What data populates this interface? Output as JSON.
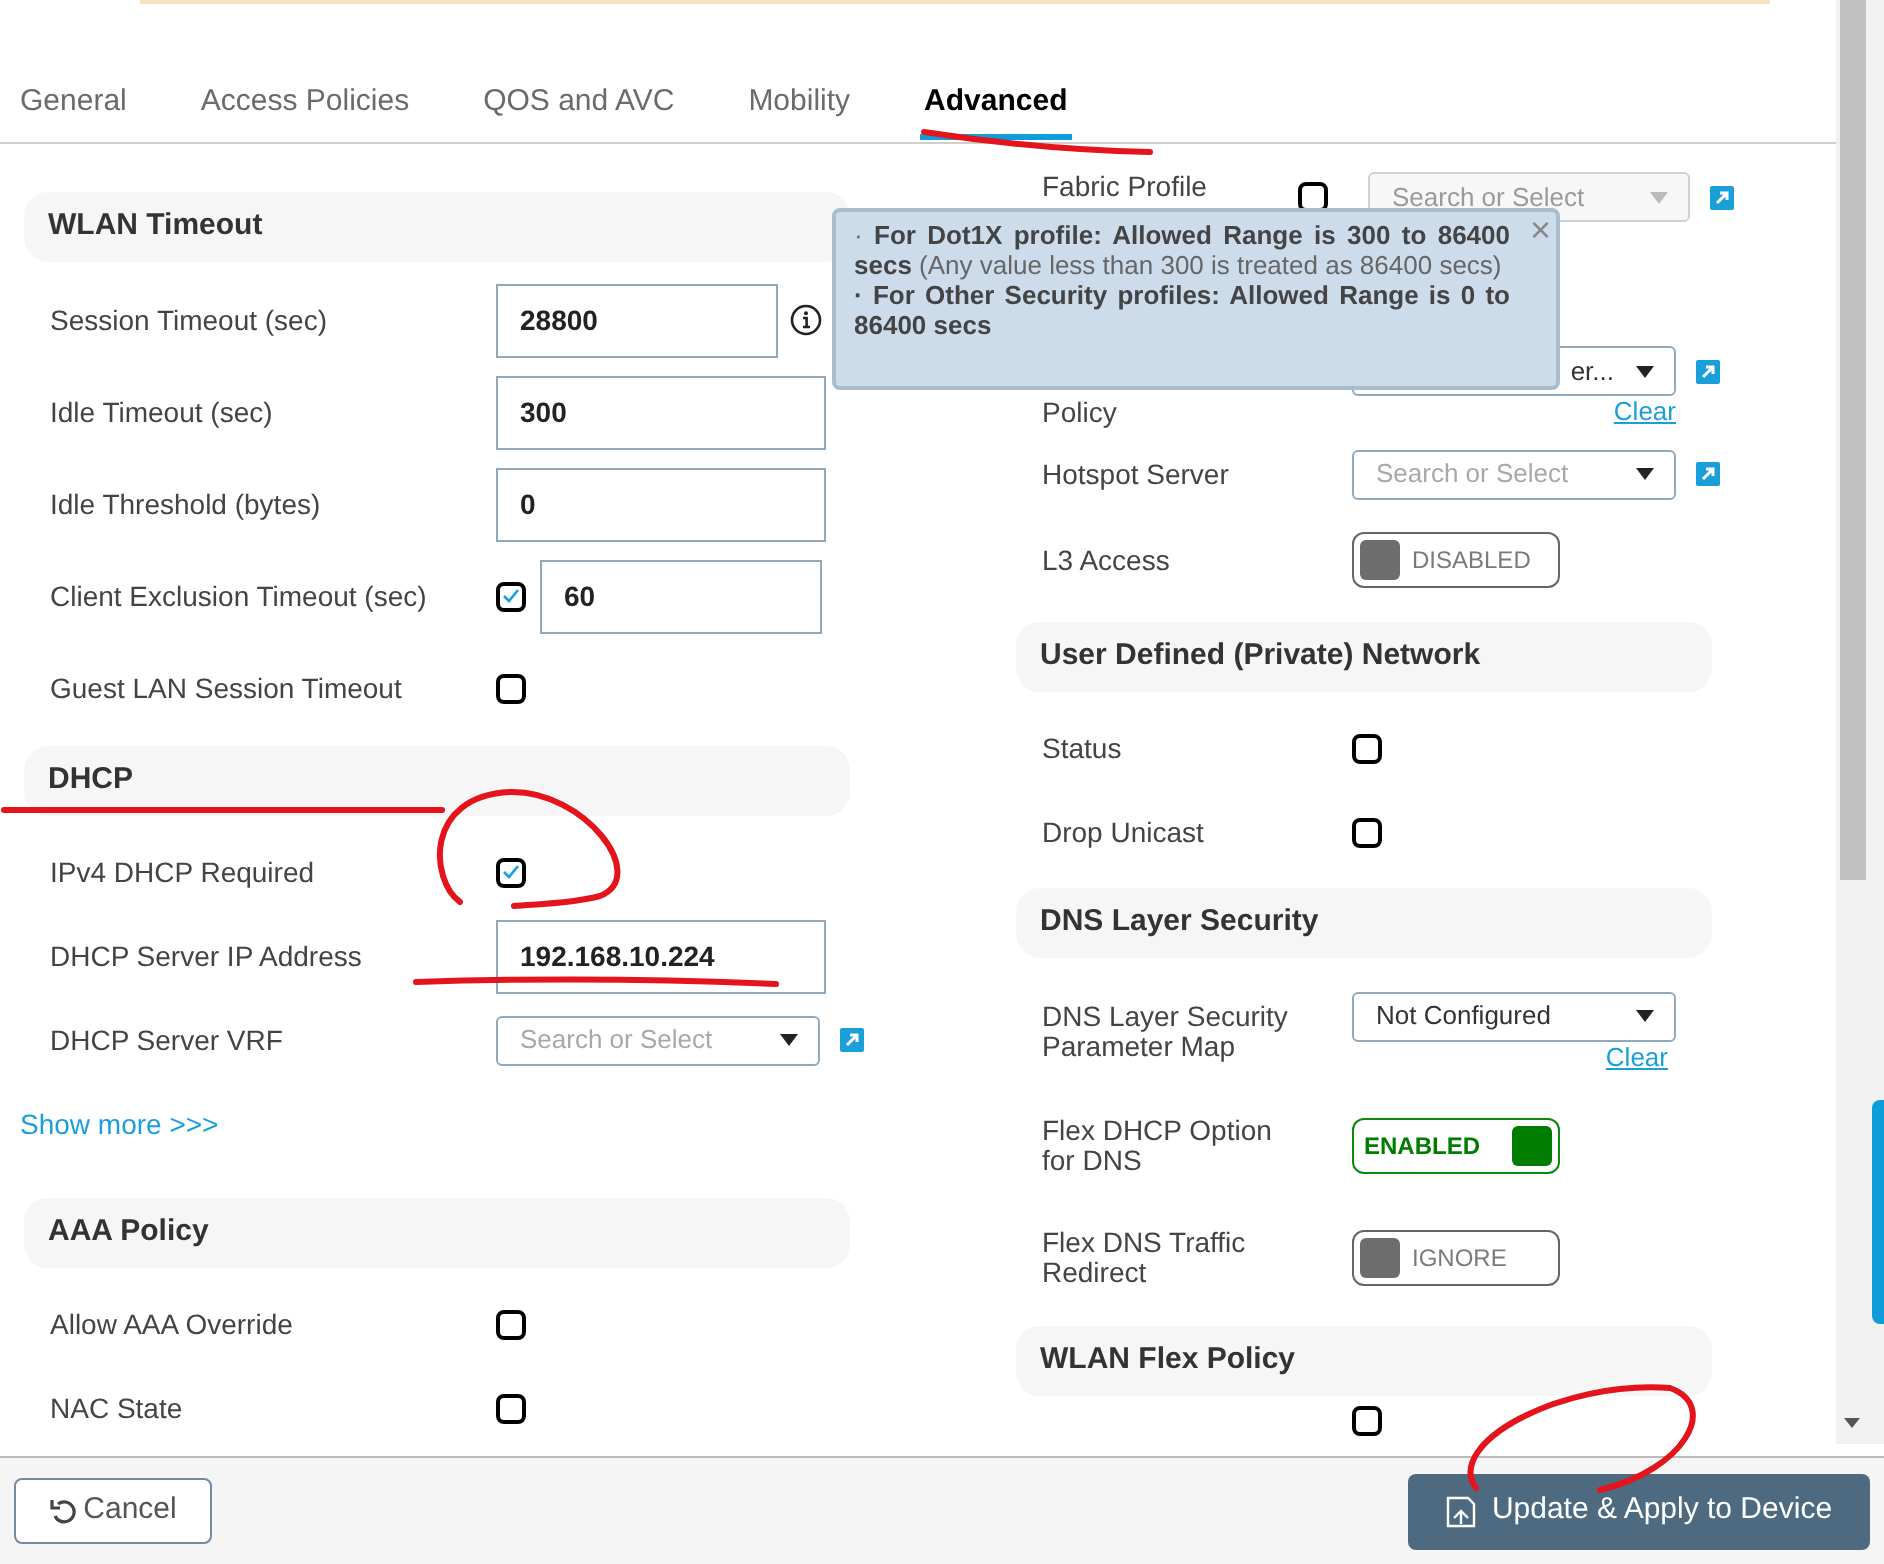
{
  "tabs": [
    {
      "label": "General",
      "selected": false
    },
    {
      "label": "Access Policies",
      "selected": false
    },
    {
      "label": "QOS and AVC",
      "selected": false
    },
    {
      "label": "Mobility",
      "selected": false
    },
    {
      "label": "Advanced",
      "selected": true
    }
  ],
  "left_sections": [
    {
      "title": "WLAN Timeout",
      "rows": [
        {
          "kind": "text",
          "label": "Session Timeout (sec)",
          "value": "28800",
          "info": true
        },
        {
          "kind": "text",
          "label": "Idle Timeout (sec)",
          "value": "300"
        },
        {
          "kind": "text",
          "label": "Idle Threshold (bytes)",
          "value": "0"
        },
        {
          "kind": "checkbox_text",
          "label": "Client Exclusion Timeout (sec)",
          "checked": true,
          "value": "60"
        },
        {
          "kind": "checkbox",
          "label": "Guest LAN Session Timeout",
          "checked": false
        }
      ]
    },
    {
      "title": "DHCP",
      "rows": [
        {
          "kind": "checkbox",
          "label": "IPv4 DHCP Required",
          "checked": true
        },
        {
          "kind": "text",
          "label": "DHCP Server IP Address",
          "value": "192.168.10.224"
        },
        {
          "kind": "select",
          "label": "DHCP Server VRF",
          "placeholder": "Search or Select",
          "external_link": true
        }
      ],
      "show_more": "Show more >>>"
    },
    {
      "title": "AAA Policy",
      "rows": [
        {
          "kind": "checkbox",
          "label": "Allow AAA Override",
          "checked": false
        },
        {
          "kind": "checkbox",
          "label": "NAC State",
          "checked": false
        }
      ]
    }
  ],
  "right_sections": [
    {
      "rows": [
        {
          "kind": "checkbox_select",
          "label": "Fabric Profile",
          "checked": false,
          "placeholder": "Search or Select",
          "disabled": true,
          "external_link": true
        },
        {
          "kind": "select",
          "label": "Policy",
          "value": "er...",
          "external_link": true,
          "clear": "Clear"
        },
        {
          "kind": "select",
          "label": "Hotspot Server",
          "placeholder": "Search or Select",
          "external_link": true
        },
        {
          "kind": "toggle",
          "label": "L3 Access",
          "on": false,
          "state_text": "DISABLED"
        }
      ]
    },
    {
      "title": "User Defined (Private) Network",
      "rows": [
        {
          "kind": "checkbox",
          "label": "Status",
          "checked": false
        },
        {
          "kind": "checkbox",
          "label": "Drop Unicast",
          "checked": false
        }
      ]
    },
    {
      "title": "DNS Layer Security",
      "rows": [
        {
          "kind": "select",
          "label": "DNS Layer Security Parameter Map",
          "value": "Not Configured",
          "clear": "Clear"
        },
        {
          "kind": "toggle",
          "label": "Flex DHCP Option for DNS",
          "on": true,
          "state_text": "ENABLED"
        },
        {
          "kind": "toggle",
          "label": "Flex DNS Traffic Redirect",
          "on": false,
          "state_text": "IGNORE"
        }
      ]
    },
    {
      "title": "WLAN Flex Policy",
      "rows": [
        {
          "kind": "checkbox",
          "checked": false
        }
      ]
    }
  ],
  "tooltip": {
    "close": "×",
    "paragraphs": [
      {
        "text": "· **For Dot1X profile: Allowed Range is 300 to 86400 secs** (Any value less than 300 is treated as 86400 secs)",
        "bold": false
      },
      {
        "text": "· For Other Security profiles: Allowed Range is 0 to 86400 secs",
        "bold": true
      }
    ]
  },
  "footer": {
    "cancel": "Cancel",
    "apply": "Update & Apply to Device"
  }
}
